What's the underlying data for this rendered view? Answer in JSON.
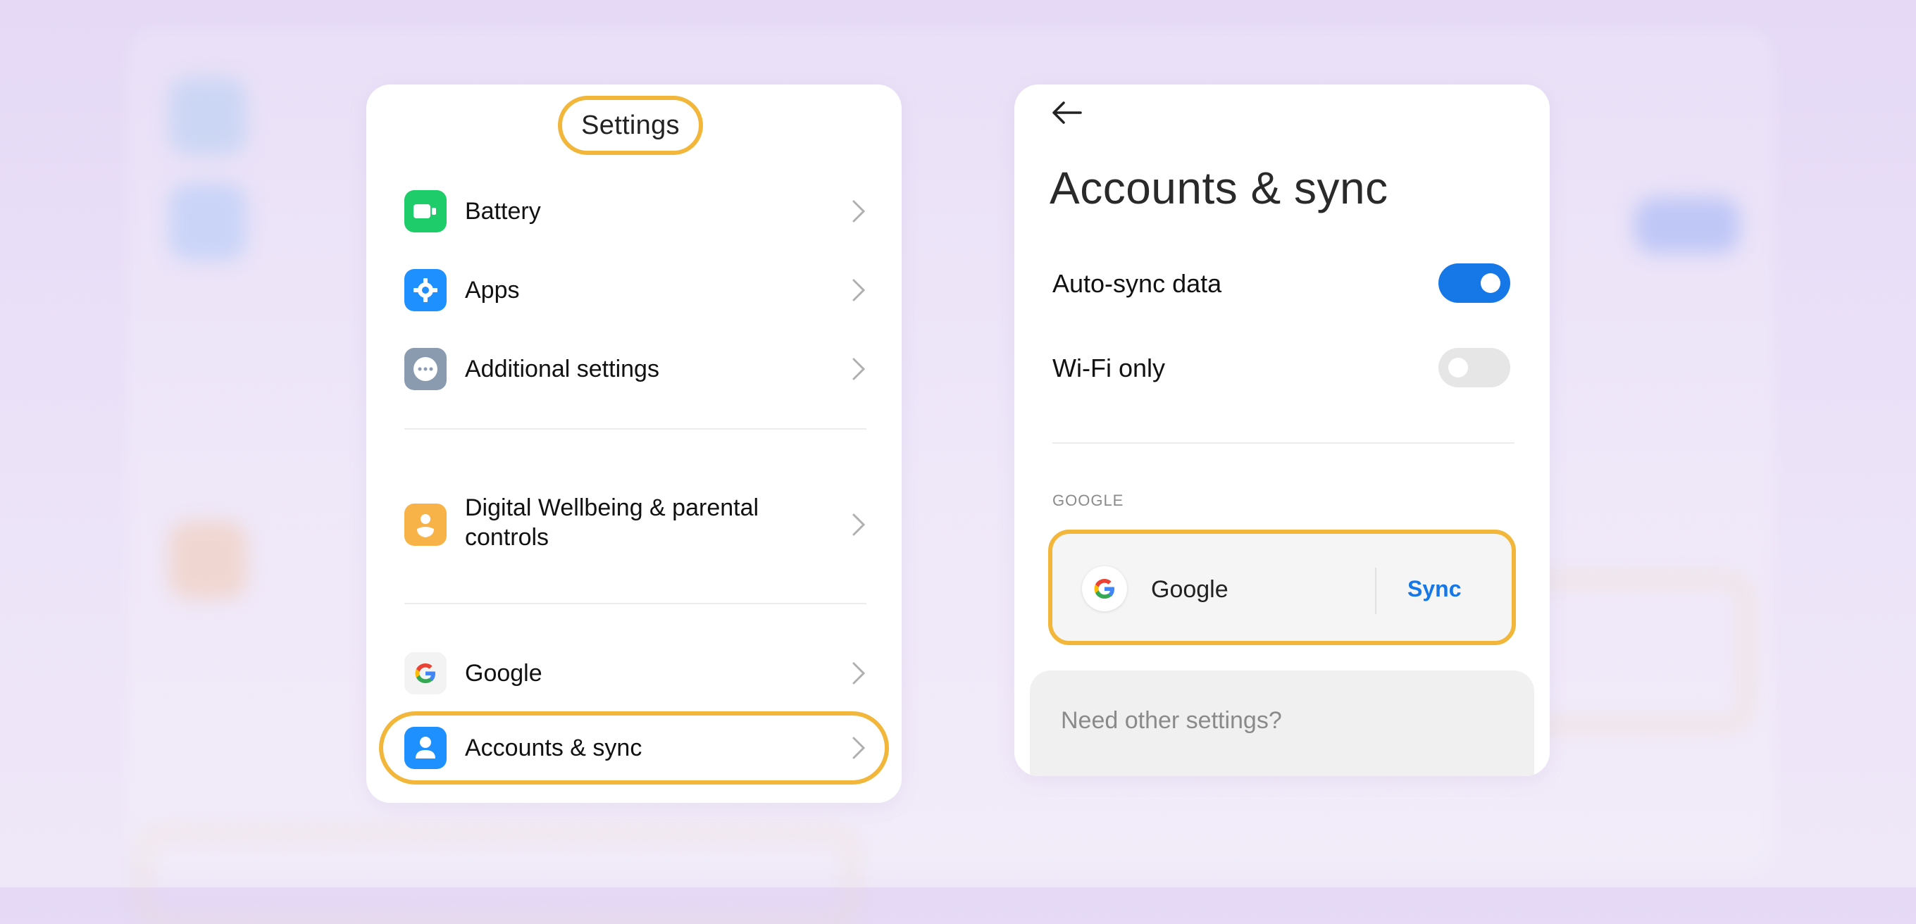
{
  "colors": {
    "accent_highlight": "#f2b63a",
    "toggle_on": "#1677e6",
    "toggle_off": "#e6e6e6",
    "battery_icon": "#1fcc6a",
    "apps_icon": "#1e90ff",
    "additional_icon": "#8a9bb0",
    "wellbeing_icon": "#f7b347",
    "accounts_icon": "#1e90ff"
  },
  "settings_panel": {
    "title": "Settings",
    "items": [
      {
        "label": "Battery",
        "icon": "battery-icon"
      },
      {
        "label": "Apps",
        "icon": "gear-icon"
      },
      {
        "label": "Additional settings",
        "icon": "more-dots-icon"
      },
      {
        "label": "Digital Wellbeing & parental controls",
        "label_line1": "Digital Wellbeing & parental",
        "label_line2": "controls",
        "icon": "wellbeing-icon"
      },
      {
        "label": "Google",
        "icon": "google-g-icon"
      },
      {
        "label": "Accounts & sync",
        "icon": "person-icon"
      }
    ]
  },
  "accounts_panel": {
    "title": "Accounts & sync",
    "auto_sync": {
      "label": "Auto-sync data",
      "enabled": true
    },
    "wifi_only": {
      "label": "Wi-Fi only",
      "enabled": false
    },
    "section_caption": "GOOGLE",
    "google_account": {
      "label": "Google",
      "action": "Sync"
    },
    "other_settings": "Need other settings?"
  }
}
